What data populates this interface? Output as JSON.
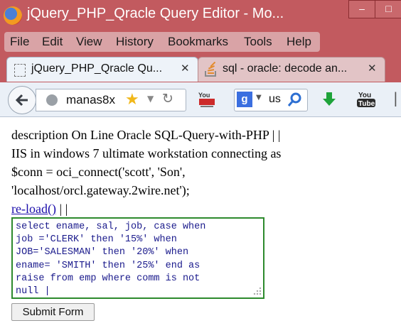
{
  "window": {
    "title": "jQuery_PHP_Qracle Query Editor - Mo...",
    "minimize_label": "–",
    "maximize_label": "□"
  },
  "menu": {
    "items": [
      {
        "label": "File"
      },
      {
        "label": "Edit"
      },
      {
        "label": "View"
      },
      {
        "label": "History"
      },
      {
        "label": "Bookmarks"
      },
      {
        "label": "Tools"
      },
      {
        "label": "Help"
      }
    ]
  },
  "tabs": [
    {
      "label": "jQuery_PHP_Qracle Qu...",
      "close": "✕",
      "active": true
    },
    {
      "label": "sql - oracle: decode an...",
      "close": "✕",
      "active": false
    }
  ],
  "tabbar_more": "ℹ",
  "toolbar": {
    "url": "manas8x",
    "search_engine": "g",
    "search_text": "us",
    "icons": [
      "back-arrow-icon",
      "globe-icon",
      "star-icon",
      "dropdown-icon",
      "reload-icon",
      "youtube-icon",
      "google-icon",
      "search-icon",
      "download-icon",
      "youtube-icon"
    ]
  },
  "page": {
    "description_line1": "description On Line Oracle SQL-Query-with-PHP | |",
    "description_line2": "IIS in windows 7 ultimate workstation connecting as",
    "description_line3": "$conn = oci_connect('scott', 'Son',",
    "description_line4": "'localhost/orcl.gateway.2wire.net');",
    "reload_link": "re-load()",
    "reload_sep": " | |",
    "query": "select ename, sal, job, case when\njob ='CLERK' then '15%' when\nJOB='SALESMAN' then '20%' when\nename= 'SMITH' then '25%' end as\nraise from emp where comm is not\nnull |",
    "submit_label": "Submit Form"
  },
  "colors": {
    "titlebar": "#c25a5f",
    "textarea_border": "#2d8a2d",
    "link": "#1a0dab"
  }
}
